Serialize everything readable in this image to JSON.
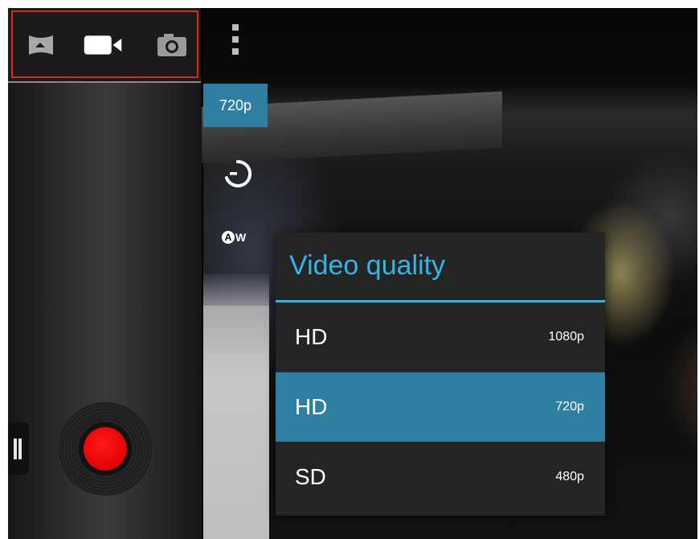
{
  "mode_bar": {
    "modes": [
      {
        "name": "panorama",
        "icon": "panorama-icon"
      },
      {
        "name": "video",
        "icon": "video-camera-icon",
        "active": true
      },
      {
        "name": "photo",
        "icon": "camera-icon"
      }
    ]
  },
  "settings": {
    "quality_chip": "720p",
    "timer_icon": "timer-icon",
    "white_balance_icon": "auto-white-balance-icon",
    "white_balance_letters": {
      "a": "A",
      "w": "W"
    },
    "overflow_icon": "overflow-menu-icon"
  },
  "controls": {
    "record_icon": "record-icon",
    "drawer_icon": "drawer-handle-icon"
  },
  "dialog": {
    "title": "Video quality",
    "options": [
      {
        "name": "HD",
        "resolution": "1080p",
        "selected": false
      },
      {
        "name": "HD",
        "resolution": "720p",
        "selected": true
      },
      {
        "name": "SD",
        "resolution": "480p",
        "selected": false
      }
    ]
  },
  "colors": {
    "accent_blue": "#33b5e5",
    "selected_blue": "#2e7fa1",
    "record_red": "#ff1a1a",
    "highlight_red": "#e02424"
  }
}
